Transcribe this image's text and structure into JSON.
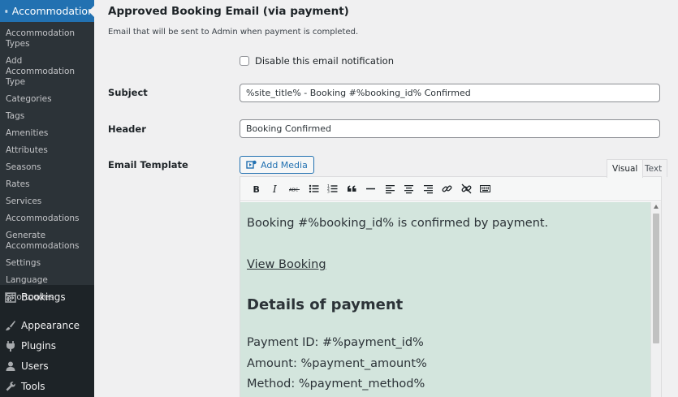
{
  "sidebar": {
    "current_menu": "Accommodation",
    "sub_items": [
      "Accommodation Types",
      "Add Accommodation Type",
      "Categories",
      "Tags",
      "Amenities",
      "Attributes",
      "Seasons",
      "Rates",
      "Services",
      "Accommodations",
      "Generate Accommodations",
      "Settings",
      "Language",
      "Shortcodes"
    ],
    "top_items": {
      "bookings": "Bookings",
      "appearance": "Appearance",
      "plugins": "Plugins",
      "users": "Users",
      "tools": "Tools"
    }
  },
  "main": {
    "title": "Approved Booking Email (via payment)",
    "description": "Email that will be sent to Admin when payment is completed.",
    "disable_label": "Disable this email notification",
    "subject_label": "Subject",
    "subject_value": "%site_title% - Booking #%booking_id% Confirmed",
    "header_label": "Header",
    "header_value": "Booking Confirmed",
    "template_label": "Email Template",
    "add_media": "Add Media",
    "tab_visual": "Visual",
    "tab_text": "Text"
  },
  "editor": {
    "line1": "Booking #%booking_id% is confirmed by payment.",
    "link": "View Booking",
    "heading": "Details of payment",
    "payment_id": "Payment ID: #%payment_id%",
    "amount": "Amount: %payment_amount%",
    "method": "Method: %payment_method%"
  }
}
